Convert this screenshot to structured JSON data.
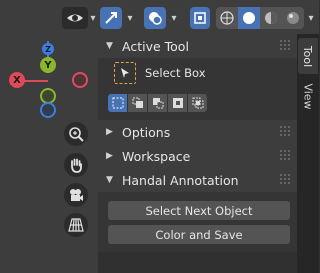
{
  "sidebar": {
    "active_tool": {
      "title": "Active Tool",
      "tool_name": "Select Box"
    },
    "options": {
      "title": "Options"
    },
    "workspace": {
      "title": "Workspace"
    },
    "handal_annotation": {
      "title": "Handal Annotation",
      "buttons": [
        "Select Next Object",
        "Color and Save"
      ]
    }
  },
  "tabs": [
    "Tool",
    "View"
  ],
  "gizmo": {
    "x_label": "X",
    "y_label": "Y",
    "z_label": "Z"
  },
  "colors": {
    "accent": "#4772b3",
    "x_axis": "#e04a56",
    "y_axis": "#88b82a",
    "z_axis": "#3b7fe3"
  }
}
